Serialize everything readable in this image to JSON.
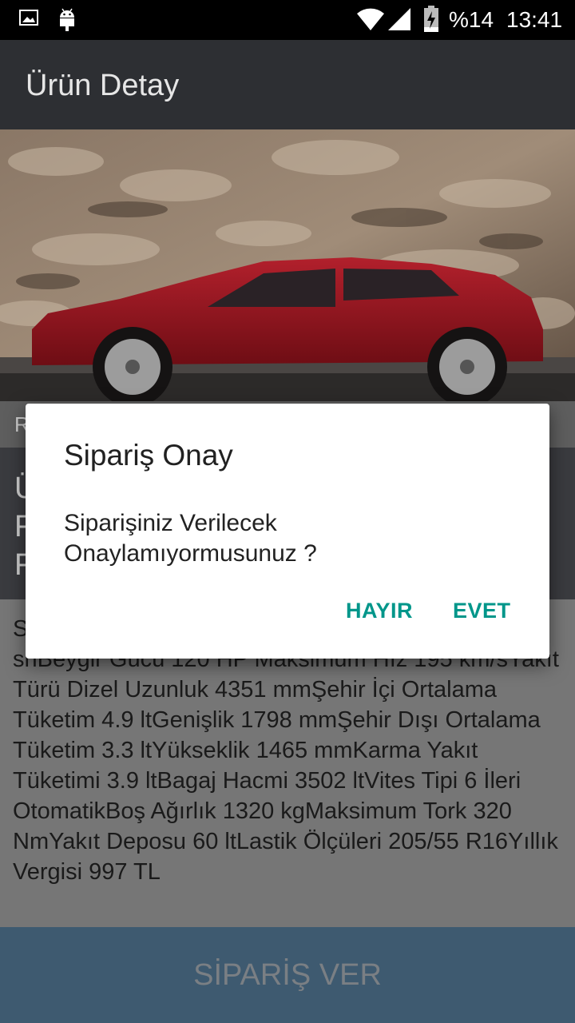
{
  "status_bar": {
    "battery_percent": "%14",
    "time": "13:41"
  },
  "app_bar": {
    "title": "Ürün Detay"
  },
  "rating_row": {
    "label": "R"
  },
  "title_block": {
    "lines": [
      "Ü",
      "F",
      "F"
    ]
  },
  "details": {
    "text": "S\nshBeygir Gücü 120 HP Maksimum Hız 195 km/sYakıt Türü Dizel Uzunluk 4351 mmŞehir İçi Ortalama Tüketim 4.9 ltGenişlik 1798 mmŞehir Dışı Ortalama Tüketim 3.3 ltYükseklik 1465 mmKarma Yakıt Tüketimi 3.9 ltBagaj Hacmi 3502 ltVites Tipi 6 İleri OtomatikBoş Ağırlık 1320 kgMaksimum Tork 320 NmYakıt Deposu 60 ltLastik Ölçüleri 205/55 R16Yıllık Vergisi 997 TL"
  },
  "order_button": {
    "label": "SİPARİŞ VER"
  },
  "dialog": {
    "title": "Sipariş Onay",
    "message": "Siparişiniz Verilecek Onaylamıyormusunuz ?",
    "negative_label": "HAYIR",
    "positive_label": "EVET",
    "accent_color": "#00968a"
  }
}
